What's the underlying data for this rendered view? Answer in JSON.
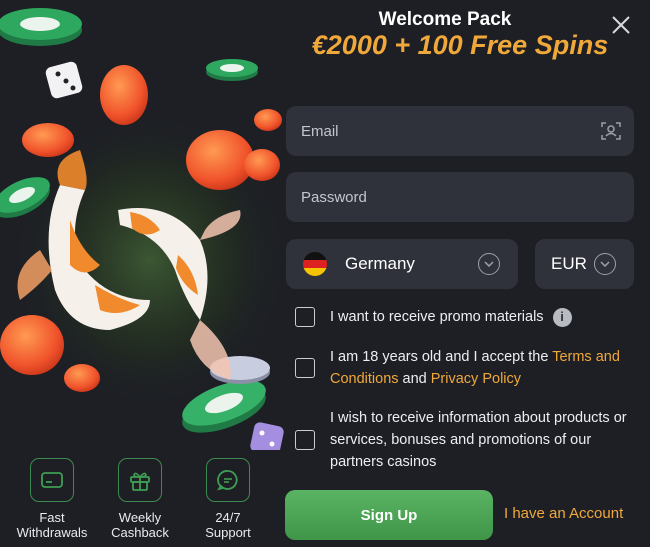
{
  "header": {
    "title": "Welcome Pack",
    "promo": "€2000 + 100 Free Spins"
  },
  "form": {
    "email_placeholder": "Email",
    "password_placeholder": "Password",
    "country": "Germany",
    "currency": "EUR",
    "consents": {
      "promo_text": "I want to receive promo materials",
      "age_prefix": "I am 18 years old and I accept the ",
      "terms_link": "Terms and Conditions",
      "age_and": " and ",
      "privacy_link": "Privacy Policy",
      "info_text": "I wish to receive information about products or services, bonuses and promotions of our partners casinos"
    },
    "signup_label": "Sign Up",
    "account_link": "I have an Account"
  },
  "features": [
    {
      "label": "Fast\nWithdrawals",
      "icon": "card-icon"
    },
    {
      "label": "Weekly\nCashback",
      "icon": "gift-icon"
    },
    {
      "label": "24/7\nSupport",
      "icon": "chat-icon"
    }
  ],
  "colors": {
    "background": "#1d1f25",
    "field": "#30323b",
    "accent_gold": "#f0a83a",
    "signup_green": "#4ca856",
    "feature_border": "#3e8a4f"
  }
}
